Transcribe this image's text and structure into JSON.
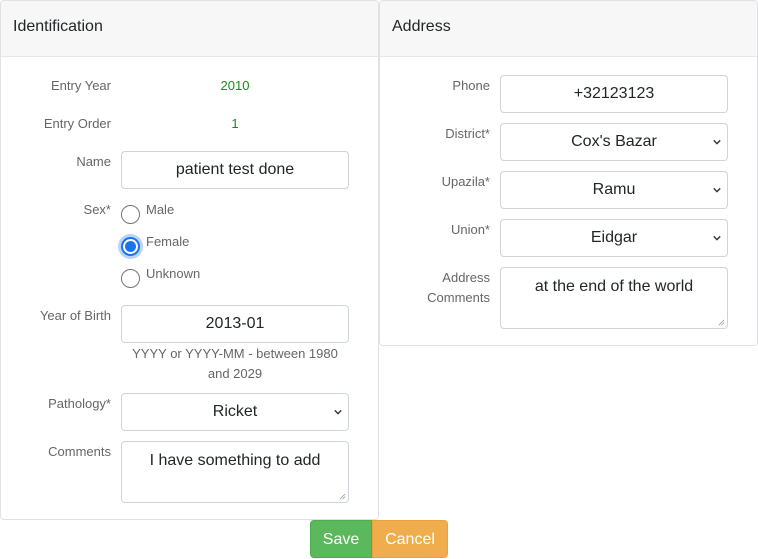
{
  "identification": {
    "title": "Identification",
    "entry_year": {
      "label": "Entry Year",
      "value": "2010"
    },
    "entry_order": {
      "label": "Entry Order",
      "value": "1"
    },
    "name": {
      "label": "Name",
      "value": "patient test done"
    },
    "sex": {
      "label": "Sex*",
      "options": [
        "Male",
        "Female",
        "Unknown"
      ],
      "selected": "Female"
    },
    "year_of_birth": {
      "label": "Year of Birth",
      "value": "2013-01",
      "help": "YYYY or YYYY-MM - between 1980 and 2029"
    },
    "pathology": {
      "label": "Pathology*",
      "value": "Ricket"
    },
    "comments": {
      "label": "Comments",
      "value": "I have something to add"
    }
  },
  "address": {
    "title": "Address",
    "phone": {
      "label": "Phone",
      "value": "+32123123"
    },
    "district": {
      "label": "District*",
      "value": "Cox's Bazar"
    },
    "upazila": {
      "label": "Upazila*",
      "value": "Ramu"
    },
    "union": {
      "label": "Union*",
      "value": "Eidgar"
    },
    "address_comments": {
      "label": "Address Comments",
      "value": "at the end of the world"
    }
  },
  "actions": {
    "save_label": "Save",
    "cancel_label": "Cancel"
  },
  "colors": {
    "save": "#5cb85c",
    "cancel": "#f0ad4e",
    "readonly_value": "#1a8a1a",
    "radio_checked": "#1a73e8"
  }
}
